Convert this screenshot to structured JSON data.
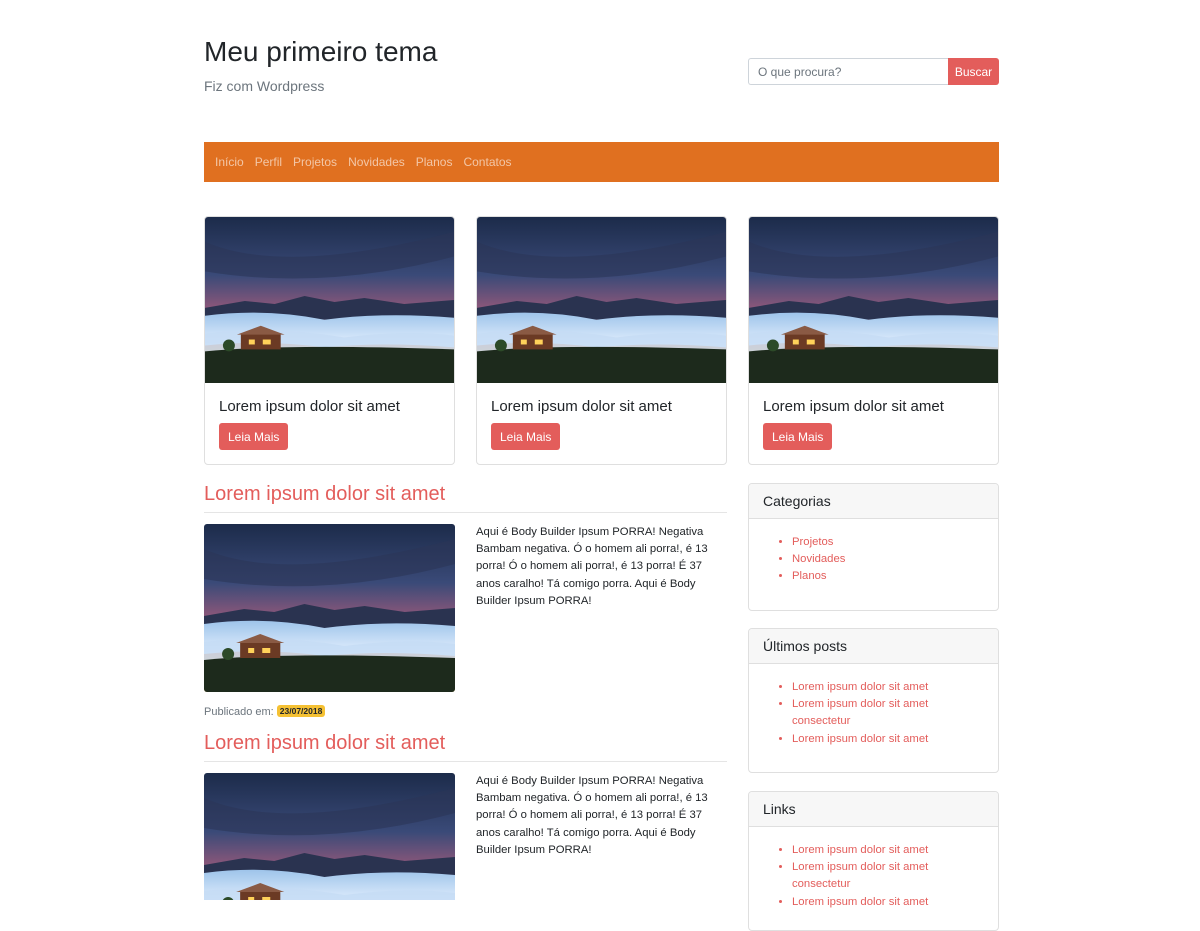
{
  "colors": {
    "accent": "#e35d5b",
    "nav_bg": "#e07020",
    "badge": "#f5c133"
  },
  "header": {
    "title": "Meu primeiro tema",
    "description": "Fiz com Wordpress",
    "search_placeholder": "O que procura?",
    "search_button": "Buscar"
  },
  "nav": {
    "items": [
      "Início",
      "Perfil",
      "Projetos",
      "Novidades",
      "Planos",
      "Contatos"
    ]
  },
  "featured": [
    {
      "title": "Lorem ipsum dolor sit amet",
      "button": "Leia Mais",
      "image": "mountain-sunset-cabin"
    },
    {
      "title": "Lorem ipsum dolor sit amet",
      "button": "Leia Mais",
      "image": "mountain-sunset-cabin"
    },
    {
      "title": "Lorem ipsum dolor sit amet",
      "button": "Leia Mais",
      "image": "mountain-sunset-cabin"
    }
  ],
  "posts": [
    {
      "title": "Lorem ipsum dolor sit amet",
      "excerpt": "Aqui é Body Builder Ipsum PORRA! Negativa Bambam negativa. Ó o homem ali porra!, é 13 porra! Ó o homem ali porra!, é 13 porra! É 37 anos caralho! Tá comigo porra. Aqui é Body Builder Ipsum PORRA!",
      "meta_label": "Publicado em:",
      "date": "23/07/2018"
    },
    {
      "title": "Lorem ipsum dolor sit amet",
      "excerpt": "Aqui é Body Builder Ipsum PORRA! Negativa Bambam negativa. Ó o homem ali porra!, é 13 porra! Ó o homem ali porra!, é 13 porra! É 37 anos caralho! Tá comigo porra. Aqui é Body Builder Ipsum PORRA!"
    }
  ],
  "sidebar": {
    "categories": {
      "title": "Categorias",
      "items": [
        "Projetos",
        "Novidades",
        "Planos"
      ]
    },
    "latest": {
      "title": "Últimos posts",
      "items": [
        "Lorem ipsum dolor sit amet",
        "Lorem ipsum dolor sit amet consectetur",
        "Lorem ipsum dolor sit amet"
      ]
    },
    "links": {
      "title": "Links",
      "items": [
        "Lorem ipsum dolor sit amet",
        "Lorem ipsum dolor sit amet consectetur",
        "Lorem ipsum dolor sit amet"
      ]
    }
  }
}
